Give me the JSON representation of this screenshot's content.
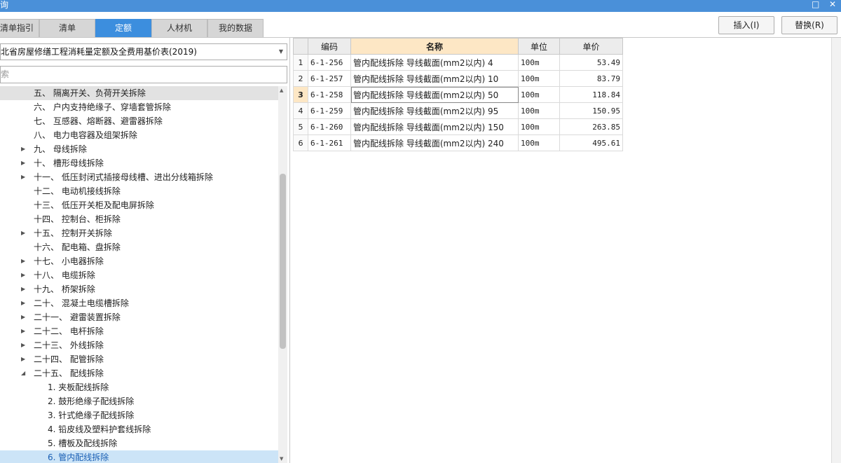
{
  "window": {
    "title": "询",
    "restore_icon": "□",
    "close_icon": "✕"
  },
  "tabs": [
    {
      "label": "清单指引",
      "active": false
    },
    {
      "label": "清单",
      "active": false
    },
    {
      "label": "定额",
      "active": true
    },
    {
      "label": "人材机",
      "active": false
    },
    {
      "label": "我的数据",
      "active": false
    }
  ],
  "actions": {
    "insert": "插入(I)",
    "replace": "替换(R)"
  },
  "quota_select": {
    "value": "北省房屋修缮工程消耗量定额及全费用基价表(2019)"
  },
  "search": {
    "placeholder": "索"
  },
  "tree": [
    {
      "label": "五、 隔离开关、负荷开关拆除",
      "expander": "",
      "indent": 1,
      "state": "selected"
    },
    {
      "label": "六、 户内支持绝缘子、穿墙套管拆除",
      "expander": "",
      "indent": 1,
      "state": ""
    },
    {
      "label": "七、 互感器、熔断器、避雷器拆除",
      "expander": "",
      "indent": 1,
      "state": ""
    },
    {
      "label": "八、 电力电容器及组架拆除",
      "expander": "",
      "indent": 1,
      "state": ""
    },
    {
      "label": "九、 母线拆除",
      "expander": "collapsed",
      "indent": 1,
      "state": ""
    },
    {
      "label": "十、 槽形母线拆除",
      "expander": "collapsed",
      "indent": 1,
      "state": ""
    },
    {
      "label": "十一、 低压封闭式插接母线槽、进出分线箱拆除",
      "expander": "collapsed",
      "indent": 1,
      "state": ""
    },
    {
      "label": "十二、 电动机接线拆除",
      "expander": "",
      "indent": 1,
      "state": ""
    },
    {
      "label": "十三、 低压开关柜及配电屏拆除",
      "expander": "",
      "indent": 1,
      "state": ""
    },
    {
      "label": "十四、 控制台、柜拆除",
      "expander": "",
      "indent": 1,
      "state": ""
    },
    {
      "label": "十五、 控制开关拆除",
      "expander": "collapsed",
      "indent": 1,
      "state": ""
    },
    {
      "label": "十六、 配电箱、盘拆除",
      "expander": "",
      "indent": 1,
      "state": ""
    },
    {
      "label": "十七、 小电器拆除",
      "expander": "collapsed",
      "indent": 1,
      "state": ""
    },
    {
      "label": "十八、 电缆拆除",
      "expander": "collapsed",
      "indent": 1,
      "state": ""
    },
    {
      "label": "十九、 桥架拆除",
      "expander": "collapsed",
      "indent": 1,
      "state": ""
    },
    {
      "label": "二十、 混凝土电缆槽拆除",
      "expander": "collapsed",
      "indent": 1,
      "state": ""
    },
    {
      "label": "二十一、 避雷装置拆除",
      "expander": "collapsed",
      "indent": 1,
      "state": ""
    },
    {
      "label": "二十二、 电杆拆除",
      "expander": "collapsed",
      "indent": 1,
      "state": ""
    },
    {
      "label": "二十三、 外线拆除",
      "expander": "collapsed",
      "indent": 1,
      "state": ""
    },
    {
      "label": "二十四、 配管拆除",
      "expander": "collapsed",
      "indent": 1,
      "state": ""
    },
    {
      "label": "二十五、 配线拆除",
      "expander": "expanded",
      "indent": 1,
      "state": ""
    },
    {
      "label": "1. 夹板配线拆除",
      "expander": "",
      "indent": 2,
      "state": ""
    },
    {
      "label": "2. 鼓形绝缘子配线拆除",
      "expander": "",
      "indent": 2,
      "state": ""
    },
    {
      "label": "3. 针式绝缘子配线拆除",
      "expander": "",
      "indent": 2,
      "state": ""
    },
    {
      "label": "4. 铅皮线及塑料护套线拆除",
      "expander": "",
      "indent": 2,
      "state": ""
    },
    {
      "label": "5. 槽板及配线拆除",
      "expander": "",
      "indent": 2,
      "state": ""
    },
    {
      "label": "6. 管内配线拆除",
      "expander": "",
      "indent": 2,
      "state": "highlighted"
    }
  ],
  "table": {
    "columns": [
      "编码",
      "名称",
      "单位",
      "单价"
    ],
    "rows": [
      {
        "index": "1",
        "code": "6-1-256",
        "name": "管内配线拆除 导线截面(mm2以内) 4",
        "unit": "100m",
        "price": "53.49"
      },
      {
        "index": "2",
        "code": "6-1-257",
        "name": "管内配线拆除 导线截面(mm2以内) 10",
        "unit": "100m",
        "price": "83.79"
      },
      {
        "index": "3",
        "code": "6-1-258",
        "name": "管内配线拆除 导线截面(mm2以内) 50",
        "unit": "100m",
        "price": "118.84"
      },
      {
        "index": "4",
        "code": "6-1-259",
        "name": "管内配线拆除 导线截面(mm2以内) 95",
        "unit": "100m",
        "price": "150.95"
      },
      {
        "index": "5",
        "code": "6-1-260",
        "name": "管内配线拆除 导线截面(mm2以内) 150",
        "unit": "100m",
        "price": "263.85"
      },
      {
        "index": "6",
        "code": "6-1-261",
        "name": "管内配线拆除 导线截面(mm2以内) 240",
        "unit": "100m",
        "price": "495.61"
      }
    ],
    "current_row": 2
  }
}
